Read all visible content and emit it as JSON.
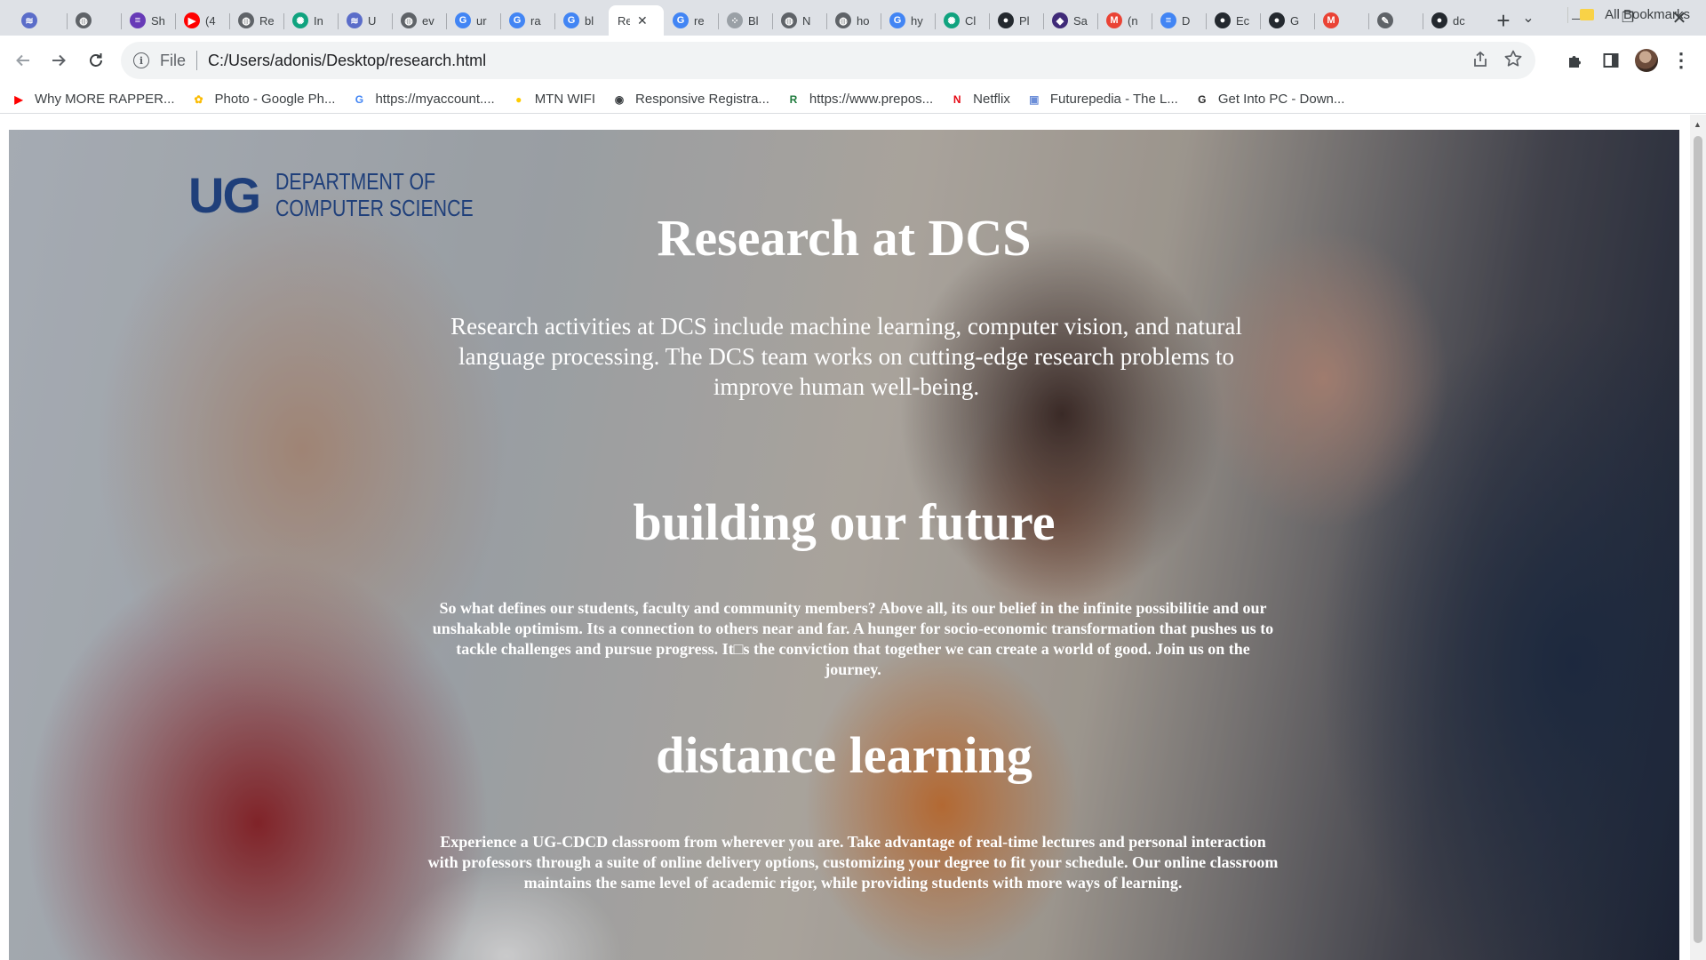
{
  "browser": {
    "tabs": [
      {
        "title": "",
        "icon": "stripes-icon",
        "color": "#5b6dc9"
      },
      {
        "title": "",
        "icon": "globe-icon",
        "color": "#5f6368"
      },
      {
        "title": "Sh",
        "icon": "list-icon",
        "color": "#673ab7"
      },
      {
        "title": "(4",
        "icon": "youtube-icon",
        "color": "#ff0000"
      },
      {
        "title": "Re",
        "icon": "globe-icon",
        "color": "#5f6368"
      },
      {
        "title": "In",
        "icon": "openai-icon",
        "color": "#10a37f"
      },
      {
        "title": "U",
        "icon": "stripes-icon",
        "color": "#5b6dc9"
      },
      {
        "title": "ev",
        "icon": "globe-icon",
        "color": "#5f6368"
      },
      {
        "title": "ur",
        "icon": "google-icon",
        "color": "#4285f4"
      },
      {
        "title": "ra",
        "icon": "google-icon",
        "color": "#4285f4"
      },
      {
        "title": "bl",
        "icon": "google-icon",
        "color": "#4285f4"
      },
      {
        "title": "Re",
        "icon": "none",
        "color": "#5f6368",
        "active": true
      },
      {
        "title": "re",
        "icon": "google-icon",
        "color": "#4285f4"
      },
      {
        "title": "Bl",
        "icon": "dots-icon",
        "color": "#9aa0a6"
      },
      {
        "title": "N",
        "icon": "globe-icon",
        "color": "#5f6368"
      },
      {
        "title": "ho",
        "icon": "globe-icon",
        "color": "#5f6368"
      },
      {
        "title": "hy",
        "icon": "google-icon",
        "color": "#4285f4"
      },
      {
        "title": "Cl",
        "icon": "openai-icon",
        "color": "#10a37f"
      },
      {
        "title": "Pl",
        "icon": "github-icon",
        "color": "#24292f"
      },
      {
        "title": "Sa",
        "icon": "crest-icon",
        "color": "#3f2a78"
      },
      {
        "title": "(n",
        "icon": "gmail-icon",
        "color": "#ea4335"
      },
      {
        "title": "D",
        "icon": "docs-icon",
        "color": "#4285f4"
      },
      {
        "title": "Ec",
        "icon": "github-icon",
        "color": "#24292f"
      },
      {
        "title": "G",
        "icon": "github-icon",
        "color": "#24292f"
      },
      {
        "title": "",
        "icon": "gmail-icon",
        "color": "#ea4335"
      },
      {
        "title": "",
        "icon": "tool-icon",
        "color": "#5f6368"
      },
      {
        "title": "dc",
        "icon": "github-icon",
        "color": "#24292f"
      }
    ],
    "active_tab_close": "✕",
    "new_tab": "+",
    "tab_search": "⌄",
    "window": {
      "minimize": "—",
      "maximize": "❐",
      "close": "✕"
    },
    "address": {
      "scheme": "File",
      "url": "C:/Users/adonis/Desktop/research.html",
      "info": "i"
    },
    "bookmarks": [
      {
        "label": "Why MORE RAPPER...",
        "icon": "youtube-icon",
        "color": "#ff0000",
        "glyph": "▶"
      },
      {
        "label": "Photo - Google Ph...",
        "icon": "photos-icon",
        "color": "#fbbc04",
        "glyph": "✿"
      },
      {
        "label": "https://myaccount....",
        "icon": "google-icon",
        "color": "#4285f4",
        "glyph": "G"
      },
      {
        "label": "MTN WIFI",
        "icon": "mtn-icon",
        "color": "#ffcc00",
        "glyph": "●"
      },
      {
        "label": "Responsive Registra...",
        "icon": "globe-icon",
        "color": "#3c4043",
        "glyph": "◉"
      },
      {
        "label": "https://www.prepos...",
        "icon": "prepos-icon",
        "color": "#1e7a3c",
        "glyph": "R"
      },
      {
        "label": "Netflix",
        "icon": "netflix-icon",
        "color": "#e50914",
        "glyph": "N"
      },
      {
        "label": "Futurepedia - The L...",
        "icon": "futurepedia-icon",
        "color": "#6c8ed8",
        "glyph": "▣"
      },
      {
        "label": "Get Into PC - Down...",
        "icon": "getintopc-icon",
        "color": "#2b2b2b",
        "glyph": "G"
      }
    ],
    "all_bookmarks": "All Bookmarks"
  },
  "page": {
    "logo": {
      "ug": "UG",
      "dept_line1": "DEPARTMENT OF",
      "dept_line2": "COMPUTER SCIENCE"
    },
    "sections": [
      {
        "title": "Research at DCS",
        "text": "Research activities at DCS include machine learning, computer vision, and natural language processing. The DCS team works on cutting-edge research problems to improve human well-being."
      },
      {
        "title": "building our future",
        "text": "So what defines our students, faculty and community members? Above all, its our belief in the infinite possibilitie and our unshakable optimism. Its a connection to others near and far. A hunger for socio-economic transformation that pushes us to tackle challenges and pursue progress. It□s the conviction that together we can create a world of good. Join us on the journey."
      },
      {
        "title": "distance learning",
        "text": "Experience a UG-CDCD classroom from wherever you are. Take advantage of real-time lectures and personal interaction with professors through a suite of online delivery options, customizing your degree to fit your schedule. Our online classroom maintains the same level of academic rigor, while providing students with more ways of learning."
      }
    ]
  }
}
